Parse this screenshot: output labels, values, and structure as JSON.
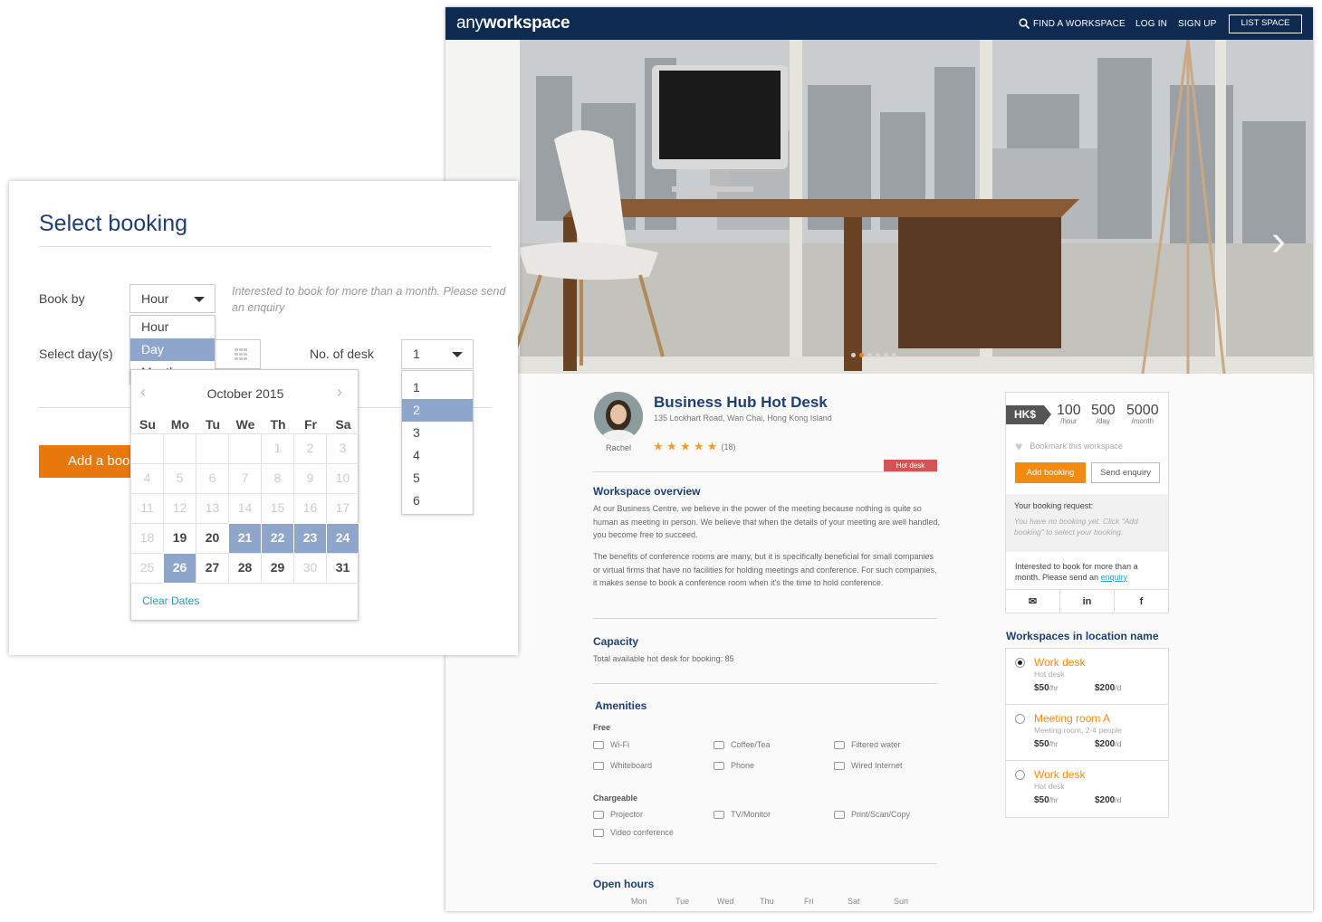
{
  "nav": {
    "logo_a": "any",
    "logo_b": "workspace",
    "find": "FIND A WORKSPACE",
    "login": "LOG IN",
    "signup": "SIGN UP",
    "list": "LIST SPACE"
  },
  "listing": {
    "title": "Business Hub Hot Desk",
    "address": "135 Lockhart Road, Wan Chai, Hong Kong Island",
    "host": "Rachel",
    "stars": "★ ★ ★ ★ ★",
    "reviews": "(18)",
    "tag": "Hot desk",
    "overview_title": "Workspace overview",
    "overview_p1": "At our Business Centre, we believe in the power of the meeting because nothing is quite so human as meeting in person. We believe that when the details of your meeting are well handled, you become free to succeed.",
    "overview_p2": "The benefits of conference rooms are many, but it is specifically beneficial for small companies or virtual firms that have no facilities for holding meetings and conference. For such companies, it makes sense to book a conference room when it's the time to hold conference.",
    "capacity_title": "Capacity",
    "capacity_text": "Total available hot desk for booking: 85",
    "amenities_title": "Amenities",
    "free_label": "Free",
    "free": [
      "Wi-Fi",
      "Coffee/Tea",
      "Filtered water",
      "Whiteboard",
      "Phone",
      "Wired Internet"
    ],
    "charge_label": "Chargeable",
    "chargeable": [
      "Projector",
      "TV/Monitor",
      "Print/Scan/Copy",
      "Video conference"
    ],
    "hours_title": "Open hours",
    "days": [
      "Mon",
      "Tue",
      "Wed",
      "Thu",
      "Fri",
      "Sat",
      "Sun"
    ]
  },
  "price": {
    "currency": "HK$",
    "hour": "100",
    "hour_unit": "/hour",
    "day": "500",
    "day_unit": "/day",
    "month": "5000",
    "month_unit": "/month",
    "bookmark": "Bookmark this workspace",
    "add": "Add booking",
    "enquiry": "Send enquiry",
    "req_title": "Your booking request:",
    "req_empty": "You have no booking yet. Click \"Add booking\" to select your booking.",
    "interest": "Interested to book for more than a month. Please send an",
    "interest_link": "enquiry"
  },
  "workspaces": {
    "title": "Workspaces in location name",
    "items": [
      {
        "name": "Work desk",
        "sub": "Hot desk",
        "p1": "$50",
        "u1": "/hr",
        "p2": "$200",
        "u2": "/d"
      },
      {
        "name": "Meeting room A",
        "sub": "Meeting room, 2-4 people",
        "p1": "$50",
        "u1": "/hr",
        "p2": "$200",
        "u2": "/d"
      },
      {
        "name": "Work desk",
        "sub": "Hot desk",
        "p1": "$50",
        "u1": "/hr",
        "p2": "$200",
        "u2": "/d"
      }
    ]
  },
  "booking": {
    "title": "Select booking",
    "book_by": "Book by",
    "book_by_value": "Hour",
    "book_by_options": [
      "Hour",
      "Day",
      "Month"
    ],
    "hint": "Interested to book for more than a month. Please send an enquiry",
    "select_days": "Select day(s)",
    "desk_label": "No. of desk",
    "desk_value": "1",
    "desk_options": [
      "1",
      "2",
      "3",
      "4",
      "5",
      "6"
    ],
    "add_button": "Add a boo",
    "month": "October 2015",
    "weekdays": [
      "Su",
      "Mo",
      "Tu",
      "We",
      "Th",
      "Fr",
      "Sa"
    ],
    "clear": "Clear Dates"
  },
  "colors": {
    "navy": "#0e2a50",
    "orange": "#f38b12",
    "selection": "#8ea6cc"
  }
}
